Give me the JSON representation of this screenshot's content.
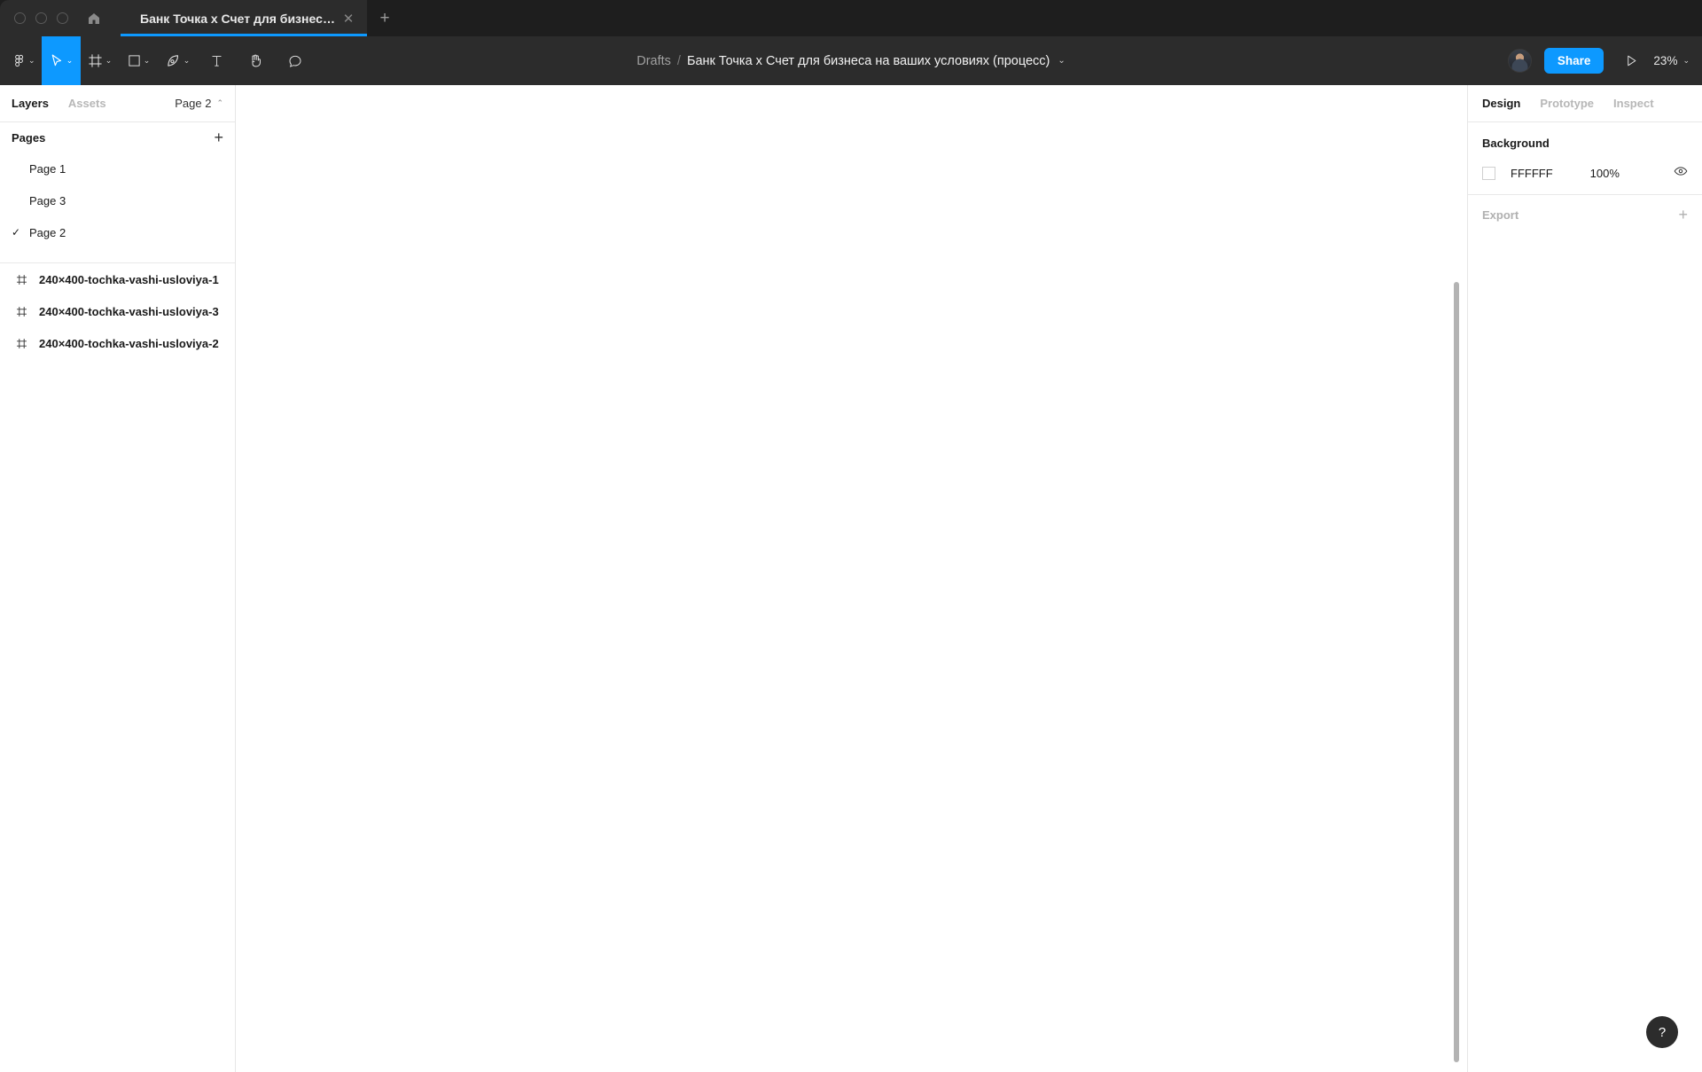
{
  "window": {
    "traffic_lights": [
      "close",
      "minimize",
      "maximize"
    ],
    "home_icon": "home-icon"
  },
  "tabs": {
    "active_tab_title": "Банк Точка х Счет для бизнеса на ...",
    "close_glyph": "✕",
    "new_tab_glyph": "+"
  },
  "toolbar": {
    "tools": [
      {
        "name": "figma-menu",
        "icon": "figma-logo-icon",
        "caret": true,
        "active": false
      },
      {
        "name": "move-tool",
        "icon": "cursor-icon",
        "caret": true,
        "active": true
      },
      {
        "name": "frame-tool",
        "icon": "frame-icon",
        "caret": true,
        "active": false
      },
      {
        "name": "shape-tool",
        "icon": "square-icon",
        "caret": true,
        "active": false
      },
      {
        "name": "pen-tool",
        "icon": "pen-icon",
        "caret": true,
        "active": false
      },
      {
        "name": "text-tool",
        "icon": "text-icon",
        "caret": false,
        "active": false
      },
      {
        "name": "hand-tool",
        "icon": "hand-icon",
        "caret": false,
        "active": false
      },
      {
        "name": "comment-tool",
        "icon": "comment-icon",
        "caret": false,
        "active": false
      }
    ],
    "breadcrumb_root": "Drafts",
    "breadcrumb_separator": "/",
    "file_name": "Банк Точка х Счет для бизнеса на ваших условиях (процесс)",
    "file_caret": "⌄",
    "share_label": "Share",
    "present_icon": "play-icon",
    "zoom_level": "23%",
    "zoom_caret": "⌄",
    "avatar": "user-avatar",
    "accent_color": "#0D99FF"
  },
  "left_panel": {
    "tabs": [
      {
        "label": "Layers",
        "active": true
      },
      {
        "label": "Assets",
        "active": false
      }
    ],
    "page_selector": "Page 2",
    "pages_header": "Pages",
    "pages_add_glyph": "+",
    "pages": [
      {
        "label": "Page 1",
        "selected": false
      },
      {
        "label": "Page 3",
        "selected": false
      },
      {
        "label": "Page 2",
        "selected": true
      }
    ],
    "check_glyph": "✓",
    "layers": [
      {
        "name": "240×400-tochka-vashi-usloviya-1",
        "icon": "frame-icon"
      },
      {
        "name": "240×400-tochka-vashi-usloviya-3",
        "icon": "frame-icon"
      },
      {
        "name": "240×400-tochka-vashi-usloviya-2",
        "icon": "frame-icon"
      }
    ]
  },
  "right_panel": {
    "tabs": [
      {
        "label": "Design",
        "active": true
      },
      {
        "label": "Prototype",
        "active": false
      },
      {
        "label": "Inspect",
        "active": false
      }
    ],
    "background": {
      "section_title": "Background",
      "hex": "FFFFFF",
      "opacity": "100%",
      "visibility_icon": "eye-icon",
      "swatch_color": "#FFFFFF"
    },
    "export": {
      "label": "Export",
      "add_glyph": "+"
    }
  },
  "canvas": {
    "background_color": "#FFFFFF",
    "scrollbar": "vertical-scrollbar"
  },
  "help": {
    "glyph": "?"
  }
}
